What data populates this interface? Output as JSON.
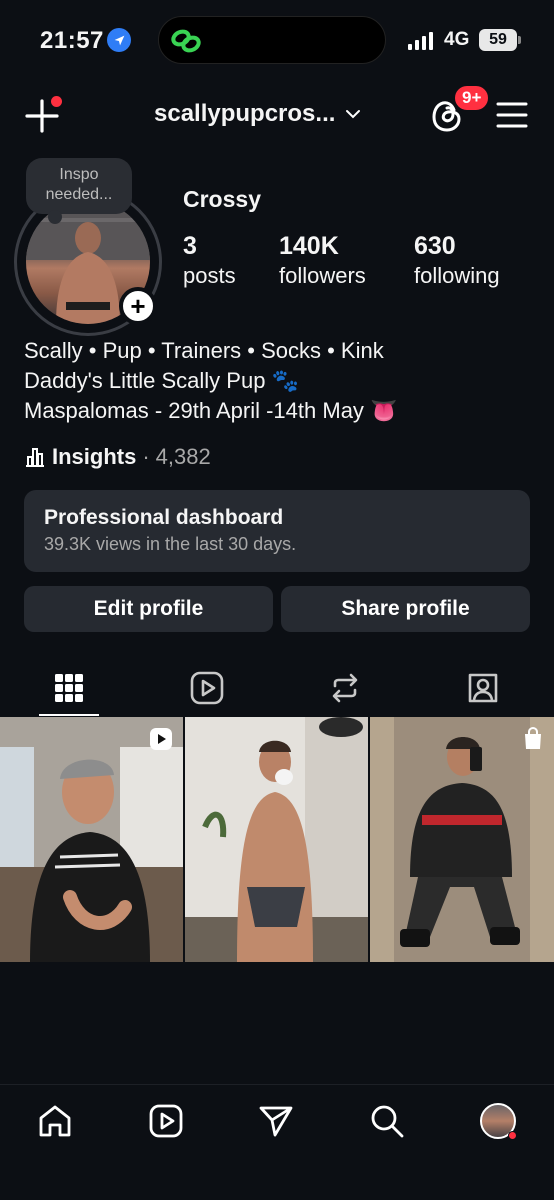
{
  "status": {
    "time": "21:57",
    "network": "4G",
    "battery": "59"
  },
  "header": {
    "username": "scallypupcros...",
    "notification_badge": "9+"
  },
  "note": {
    "text": "Inspo needed..."
  },
  "profile": {
    "name": "Crossy",
    "stats": [
      {
        "value": "3",
        "label": "posts"
      },
      {
        "value": "140K",
        "label": "followers"
      },
      {
        "value": "630",
        "label": "following"
      }
    ],
    "bio": [
      "Scally • Pup • Trainers • Socks • Kink",
      "Daddy's Little Scally Pup 🐾",
      "Maspalomas - 29th April -14th May 👅"
    ]
  },
  "insights": {
    "label": "Insights",
    "separator": "·",
    "count": "4,382"
  },
  "dashboard": {
    "title": "Professional dashboard",
    "subtitle": "39.3K views in the last 30 days."
  },
  "buttons": {
    "edit": "Edit profile",
    "share": "Share profile"
  },
  "tabs": [
    "grid-icon",
    "reels-icon",
    "reposts-icon",
    "tagged-icon"
  ],
  "posts": [
    {
      "type": "reel",
      "icon": "reel-icon"
    },
    {
      "type": "photo",
      "icon": ""
    },
    {
      "type": "photo",
      "icon": "shopping-bag-icon"
    }
  ],
  "nav": [
    "home-icon",
    "reels-icon",
    "direct-icon",
    "search-icon",
    "profile-avatar"
  ],
  "colors": {
    "background": "#0c0f14",
    "surface": "#262a31",
    "accent_red": "#ff3040",
    "location_blue": "#2f7df6",
    "muted_text": "#a8a8a8"
  }
}
